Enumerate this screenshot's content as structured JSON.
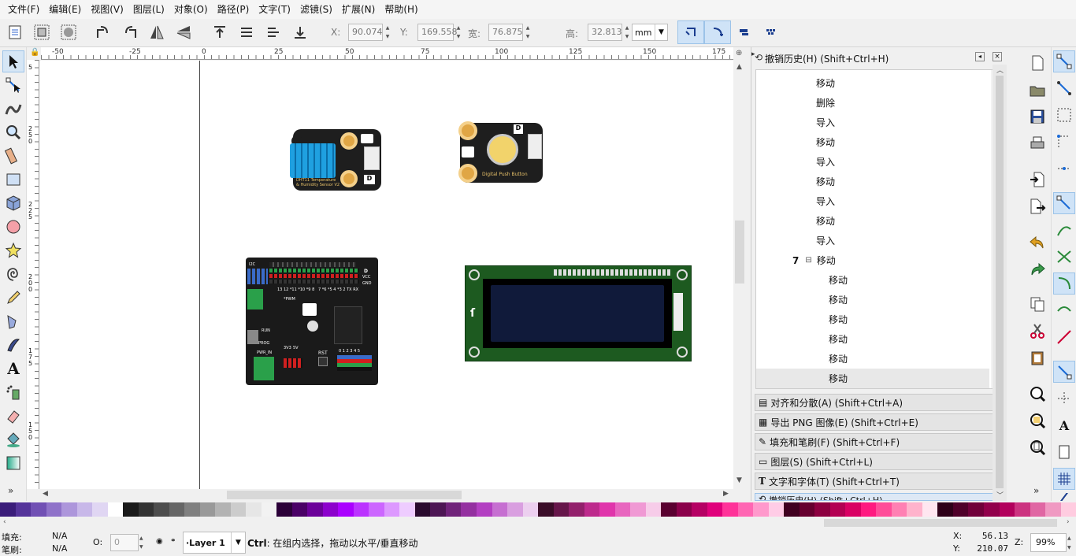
{
  "menu": [
    "文件(F)",
    "编辑(E)",
    "视图(V)",
    "图层(L)",
    "对象(O)",
    "路径(P)",
    "文字(T)",
    "滤镜(S)",
    "扩展(N)",
    "帮助(H)"
  ],
  "toolbar": {
    "x_label": "X:",
    "x_value": "90.074",
    "y_label": "Y:",
    "y_value": "169.558",
    "w_label": "宽:",
    "w_value": "76.875",
    "h_label": "高:",
    "h_value": "32.813",
    "unit": "mm"
  },
  "ruler": {
    "h_ticks": [
      "-50",
      "-25",
      "0",
      "25",
      "50",
      "75",
      "100",
      "125",
      "150",
      "175"
    ],
    "v_ticks": [
      "5",
      "2 5 0",
      "2 2 5",
      "2 0 0",
      "1 7 5",
      "1 5 0"
    ]
  },
  "canvas_items": {
    "dht11": {
      "line1": "DHT11 Temperature",
      "line2": "& Humidity Sensor V2"
    },
    "button": {
      "label": "Digital Push Button",
      "pin": "D"
    },
    "shield": {
      "i2c": "I2C",
      "d": "D",
      "vcc": "VCC",
      "gnd": "GND",
      "pwm": "*PWM",
      "run": "RUN",
      "prog": "PROG",
      "pwr_in": "PWR_IN",
      "rst": "RST",
      "v33": "3V3",
      "v5": "5V",
      "nums": "13 12 *11 *10 *9 8",
      "nums2": "7 *6 *5 4 *3 2 TX RX",
      "analog": "0 1 2 3 4 5"
    }
  },
  "history_panel": {
    "title": "撤销历史(H) (Shift+Ctrl+H)",
    "items": [
      {
        "label": "移动",
        "indent": 1
      },
      {
        "label": "删除",
        "indent": 1
      },
      {
        "label": "导入",
        "indent": 1
      },
      {
        "label": "移动",
        "indent": 1
      },
      {
        "label": "导入",
        "indent": 1
      },
      {
        "label": "移动",
        "indent": 1
      },
      {
        "label": "导入",
        "indent": 1
      },
      {
        "label": "移动",
        "indent": 1
      },
      {
        "label": "导入",
        "indent": 1
      },
      {
        "label": "移动",
        "indent": 1,
        "count": "7",
        "expander": "⊟"
      },
      {
        "label": "移动",
        "indent": 2
      },
      {
        "label": "移动",
        "indent": 2
      },
      {
        "label": "移动",
        "indent": 2
      },
      {
        "label": "移动",
        "indent": 2
      },
      {
        "label": "移动",
        "indent": 2
      },
      {
        "label": "移动",
        "indent": 2,
        "selected": true
      }
    ]
  },
  "dock_tabs": [
    "对齐和分散(A) (Shift+Ctrl+A)",
    "导出 PNG 图像(E) (Shift+Ctrl+E)",
    "填充和笔刷(F) (Shift+Ctrl+F)",
    "图层(S) (Shift+Ctrl+L)",
    "文字和字体(T) (Shift+Ctrl+T)",
    "撤销历史(H) (Shift+Ctrl+H)"
  ],
  "palette_colors": [
    "#3b1d7a",
    "#55349a",
    "#7150b4",
    "#8f72c9",
    "#ad96db",
    "#c8b8e9",
    "#e0d6f3",
    "#ffffff",
    "#1a1a1a",
    "#333333",
    "#4d4d4d",
    "#666666",
    "#808080",
    "#999999",
    "#b3b3b3",
    "#cccccc",
    "#e6e6e6",
    "#f2f2f2",
    "#2b0038",
    "#4a0066",
    "#6b0099",
    "#8c00cc",
    "#aa00ff",
    "#bb33ff",
    "#cc66ff",
    "#dd99ff",
    "#eeccff",
    "#2a0b2e",
    "#4d1654",
    "#70237a",
    "#9430a0",
    "#b33fc2",
    "#c66fd1",
    "#d99fe0",
    "#eccfef",
    "#3a0d28",
    "#66164a",
    "#92206b",
    "#bd2a8c",
    "#e035ab",
    "#e866bf",
    "#f099d4",
    "#f7cce9",
    "#5a0030",
    "#8a004a",
    "#b50063",
    "#e0007b",
    "#ff3399",
    "#ff66b3",
    "#ff99cc",
    "#ffcce6",
    "#400020",
    "#66002f",
    "#8c0040",
    "#b30052",
    "#d90063",
    "#ff1a80",
    "#ff4d99",
    "#ff80b3",
    "#ffb3cc",
    "#ffe6f0",
    "#2e0018",
    "#4f0029",
    "#70003a",
    "#91004b",
    "#b2005c",
    "#cc3380",
    "#e066a3",
    "#f099c2",
    "#ffcce0"
  ],
  "status": {
    "fill_label": "填充:",
    "fill_value": "N/A",
    "stroke_label": "笔刷:",
    "stroke_value": "N/A",
    "opacity_label": "O:",
    "opacity_value": "0",
    "layer": "·Layer 1",
    "hint_bold": "Ctrl",
    "hint": ": 在组内选择，拖动以水平/垂直移动",
    "x_label": "X:",
    "x_value": "56.13",
    "y_label": "Y:",
    "y_value": "210.07",
    "z_label": "Z:",
    "zoom": "99%"
  }
}
